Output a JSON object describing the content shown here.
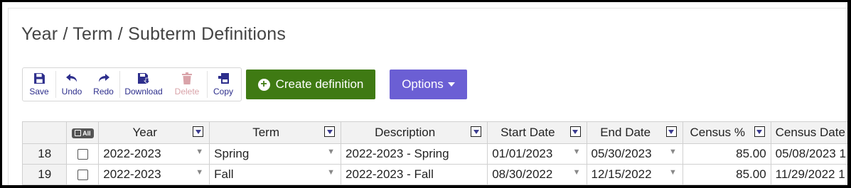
{
  "page": {
    "title": "Year / Term / Subterm Definitions"
  },
  "toolbar": {
    "save": "Save",
    "undo": "Undo",
    "redo": "Redo",
    "download": "Download",
    "delete": "Delete",
    "copy": "Copy"
  },
  "actions": {
    "create": "Create definition",
    "options": "Options"
  },
  "grid": {
    "select_all": "All",
    "columns": [
      "Year",
      "Term",
      "Description",
      "Start Date",
      "End Date",
      "Census %",
      "Census Date"
    ],
    "rows": [
      {
        "num": "18",
        "year": "2022-2023",
        "term": "Spring",
        "description": "2022-2023 - Spring",
        "start": "01/01/2023",
        "end": "05/30/2023",
        "census_pct": "85.00",
        "census_date": "05/08/2023 1"
      },
      {
        "num": "19",
        "year": "2022-2023",
        "term": "Fall",
        "description": "2022-2023 - Fall",
        "start": "08/30/2022",
        "end": "12/15/2022",
        "census_pct": "85.00",
        "census_date": "11/29/2022 1"
      }
    ]
  },
  "colors": {
    "create_bg": "#3f7a13",
    "options_bg": "#6b5fd4",
    "toolbar_text": "#2d2e8c"
  }
}
